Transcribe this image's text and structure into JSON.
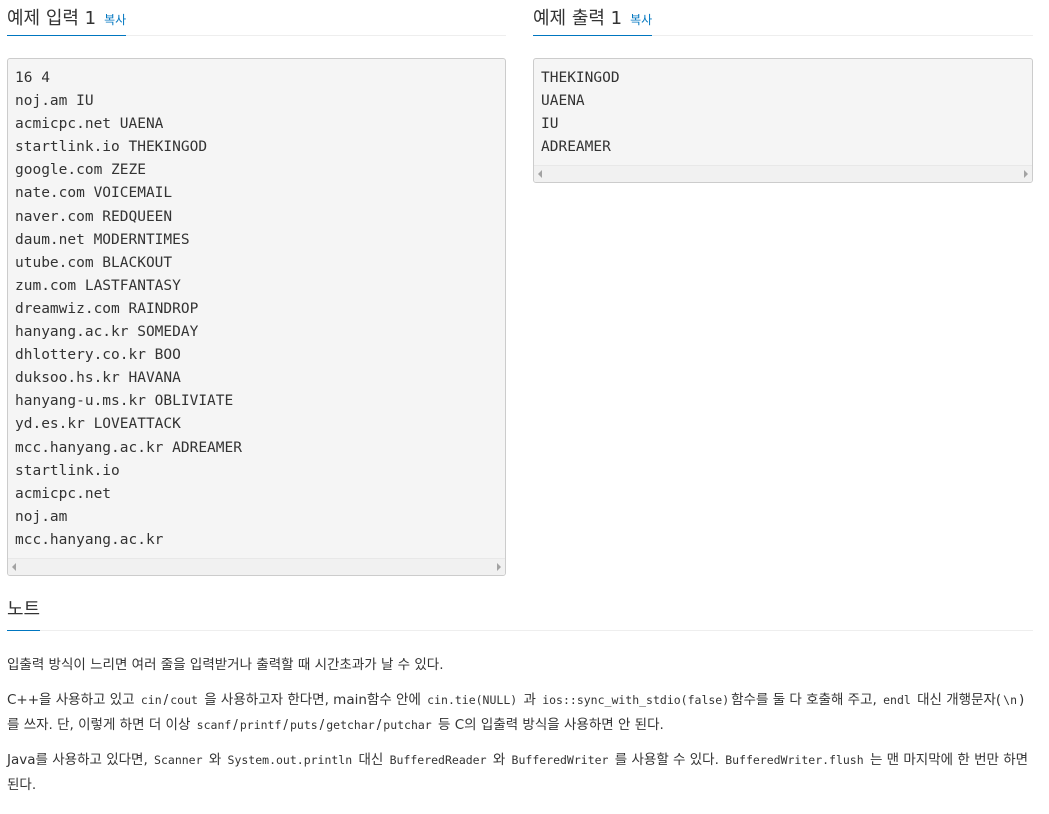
{
  "input_section": {
    "title": "예제 입력 1",
    "copy_label": "복사",
    "text": "16 4\nnoj.am IU\nacmicpc.net UAENA\nstartlink.io THEKINGOD\ngoogle.com ZEZE\nnate.com VOICEMAIL\nnaver.com REDQUEEN\ndaum.net MODERNTIMES\nutube.com BLACKOUT\nzum.com LASTFANTASY\ndreamwiz.com RAINDROP\nhanyang.ac.kr SOMEDAY\ndhlottery.co.kr BOO\nduksoo.hs.kr HAVANA\nhanyang-u.ms.kr OBLIVIATE\nyd.es.kr LOVEATTACK\nmcc.hanyang.ac.kr ADREAMER\nstartlink.io\nacmicpc.net\nnoj.am\nmcc.hanyang.ac.kr"
  },
  "output_section": {
    "title": "예제 출력 1",
    "copy_label": "복사",
    "text": "THEKINGOD\nUAENA\nIU\nADREAMER"
  },
  "note": {
    "title": "노트",
    "p1": "입출력 방식이 느리면 여러 줄을 입력받거나 출력할 때 시간초과가 날 수 있다.",
    "p2": {
      "t1": "C++을 사용하고 있고",
      "c1": "cin",
      "t2": "/",
      "c2": "cout",
      "t3": "을 사용하고자 한다면, main함수 안에",
      "c3": "cin.tie(NULL)",
      "t4": "과",
      "c4": "ios::sync_with_stdio(false)",
      "t5": "함수를  둘 다 호출해 주고,",
      "c5": "endl",
      "t6": "대신 개행문자(",
      "c6": "\\n",
      "t7": ")를 쓰자. 단, 이렇게 하면 더 이상",
      "c7": "scanf",
      "t8": "/",
      "c8": "printf",
      "t9": "/",
      "c9": "puts",
      "t10": "/",
      "c10": "getchar",
      "t11": "/",
      "c11": "putchar",
      "t12": "등 C의 입출력 방식을 사용하면 안 된다."
    },
    "p3": {
      "t1": "Java를 사용하고 있다면,",
      "c1": "Scanner",
      "t2": "와",
      "c2": "System.out.println",
      "t3": "대신",
      "c3": "BufferedReader",
      "t4": "와",
      "c4": "BufferedWriter",
      "t5": "를 사용할 수 있다.",
      "c5": "BufferedWriter.flush",
      "t6": "는 맨 마지막에 한 번만 하면 된다."
    }
  }
}
